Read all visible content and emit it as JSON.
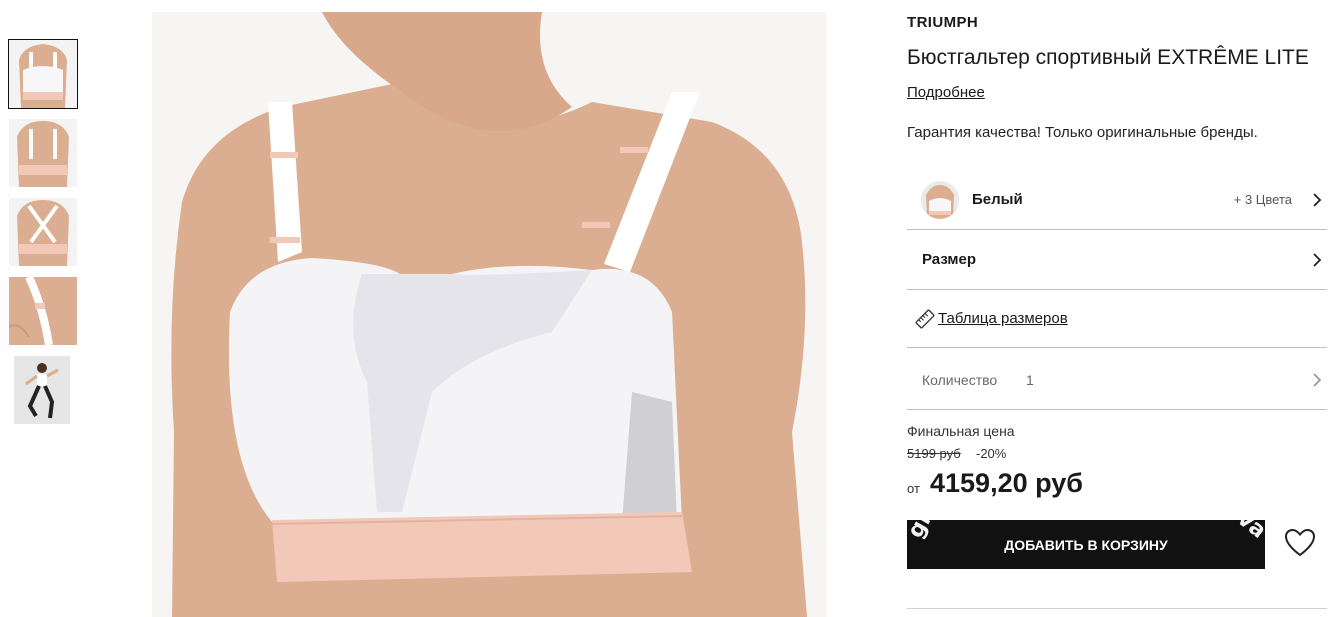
{
  "product": {
    "brand": "TRIUMPH",
    "title": "Бюстгальтер спортивный EXTRÊME LITE",
    "details_link": "Подробнее",
    "guarantee": "Гарантия качества! Только оригинальные бренды."
  },
  "color": {
    "name": "Белый",
    "more": "+ 3 Цвета"
  },
  "size": {
    "label": "Размер",
    "table_link": "Таблица размеров"
  },
  "quantity": {
    "label": "Количество",
    "value": "1"
  },
  "price": {
    "final_label": "Финальная цена",
    "old": "5199 руб",
    "discount": "-20%",
    "from": "от",
    "current": "4159,20 руб"
  },
  "cart": {
    "button": "ДОБАВИТЬ В КОРЗИНУ",
    "watermark_left": "grov.ru",
    "watermark_right": "ptova"
  },
  "icons": {
    "chevron": "chevron-right-icon",
    "ruler": "ruler-icon",
    "wishlist": "heart-icon"
  },
  "colors": {
    "button_bg": "#111111",
    "skin": "#dcae91",
    "fabric": "#f4f4f6",
    "band": "#f2c9b9"
  },
  "thumbnails": [
    "front",
    "back",
    "cross-back",
    "strap-detail",
    "model-action"
  ]
}
